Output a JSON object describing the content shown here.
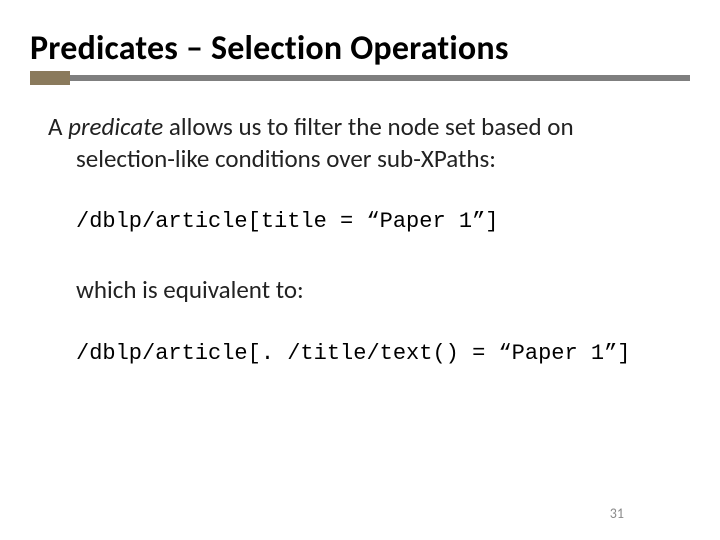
{
  "title": "Predicates – Selection Operations",
  "intro": {
    "lead_a": "A ",
    "term": "predicate",
    "lead_b": " allows us to filter the node set based on",
    "cont": "selection-like conditions over sub-XPaths:"
  },
  "code1": "/dblp/article[title = “Paper 1”]",
  "equiv": "which is equivalent to:",
  "code2": "/dblp/article[. /title/text() = “Paper 1”]",
  "page_number": "31"
}
